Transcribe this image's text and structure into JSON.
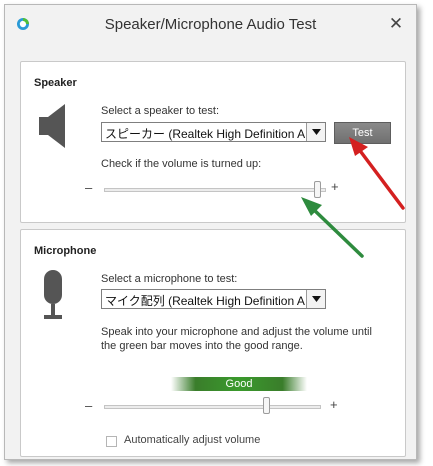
{
  "window": {
    "title": "Speaker/Microphone Audio Test",
    "close_label": "✕"
  },
  "speaker": {
    "heading": "Speaker",
    "select_label": "Select a speaker to test:",
    "selected_device": "スピーカー (Realtek High Definition Audio)",
    "test_label": "Test",
    "volume_label": "Check if the volume is turned up:",
    "volume_level": 0.96,
    "minus": "–",
    "plus": "+"
  },
  "microphone": {
    "heading": "Microphone",
    "select_label": "Select a microphone to test:",
    "selected_device": "マイク配列 (Realtek High Definition Audio)",
    "instructions_line1": "Speak into your microphone and adjust the volume until",
    "instructions_line2": "the green bar moves into the good range.",
    "level_label": "Good",
    "volume_level": 0.75,
    "minus": "–",
    "plus": "+",
    "auto_adjust_label": "Automatically adjust volume",
    "auto_adjust_checked": false
  },
  "colors": {
    "arrow_red": "#d42020",
    "arrow_green": "#2e8b3e",
    "good_green": "#3a9a2c"
  }
}
